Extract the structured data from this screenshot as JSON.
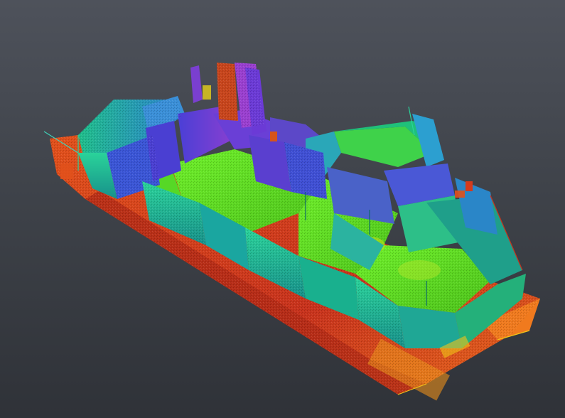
{
  "viewer": {
    "colors": {
      "background_top": "#4e525b",
      "background_bottom": "#2f3238",
      "floor": "#5fe31f",
      "floor_dark": "#4cc21a",
      "wall_green": "#1fbf8a",
      "wall_teal": "#1aa6a0",
      "wall_blue": "#3a4fd6",
      "wall_purple": "#7a3fd0",
      "wall_magenta": "#b23fd0",
      "base_orange": "#e2511b",
      "base_red": "#c8321c",
      "base_yellow": "#f2c318"
    }
  }
}
